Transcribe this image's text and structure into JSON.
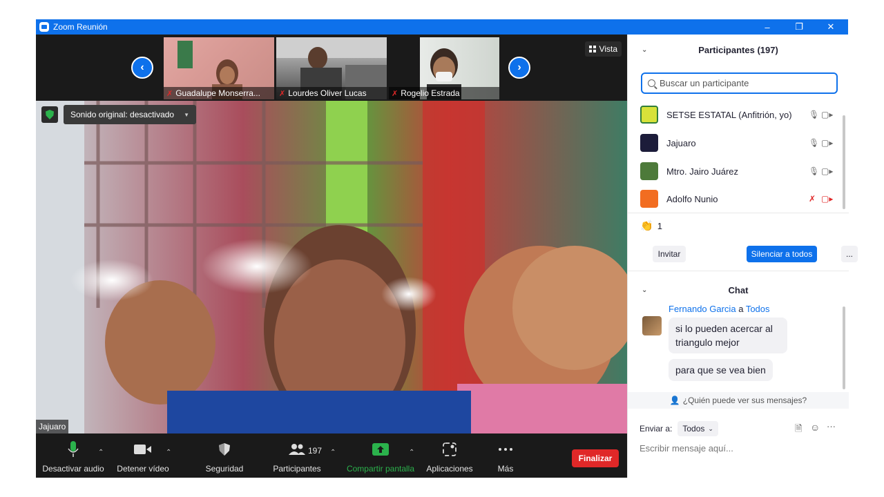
{
  "window": {
    "title": "Zoom Reunión"
  },
  "strip": {
    "thumbnails": [
      {
        "name": "Guadalupe Monserra..."
      },
      {
        "name": "Lourdes Oliver Lucas"
      },
      {
        "name": "Rogelio Estrada"
      }
    ],
    "view_label": "Vista"
  },
  "video": {
    "audio_label": "Sonido original: desactivado",
    "speaker_name": "Jajuaro"
  },
  "toolbar": {
    "audio": "Desactivar audio",
    "video": "Detener vídeo",
    "security": "Seguridad",
    "participants": "Participantes",
    "participants_count": "197",
    "share": "Compartir pantalla",
    "apps": "Aplicaciones",
    "more": "Más",
    "end": "Finalizar"
  },
  "participants": {
    "title": "Participantes (197)",
    "search_placeholder": "Buscar un participante",
    "list": [
      {
        "name": "SETSE ESTATAL (Anfitrión, yo)",
        "avatar_color": "#d7e23a"
      },
      {
        "name": "Jajuaro",
        "avatar_color": "#1c1c3a"
      },
      {
        "name": "Mtro. Jairo Juárez",
        "avatar_color": "#4d7a3a"
      },
      {
        "name": "Adolfo Nunio",
        "avatar_color": "#f26d21"
      }
    ],
    "reaction_count": "1",
    "invite": "Invitar",
    "mute_all": "Silenciar a todos",
    "more": "..."
  },
  "chat": {
    "title": "Chat",
    "sender": "Fernando Garcia",
    "to_word": "a",
    "recipient": "Todos",
    "messages": [
      "si lo pueden acercar al triangulo mejor",
      "para que se vea bien"
    ],
    "who_can_see": "¿Quién puede ver sus mensajes?",
    "send_to_label": "Enviar a:",
    "send_to_value": "Todos",
    "input_placeholder": "Escribir mensaje aquí..."
  },
  "colors": {
    "zoom_blue": "#0e71eb",
    "end_red": "#e02828",
    "share_green": "#2bb24c"
  }
}
